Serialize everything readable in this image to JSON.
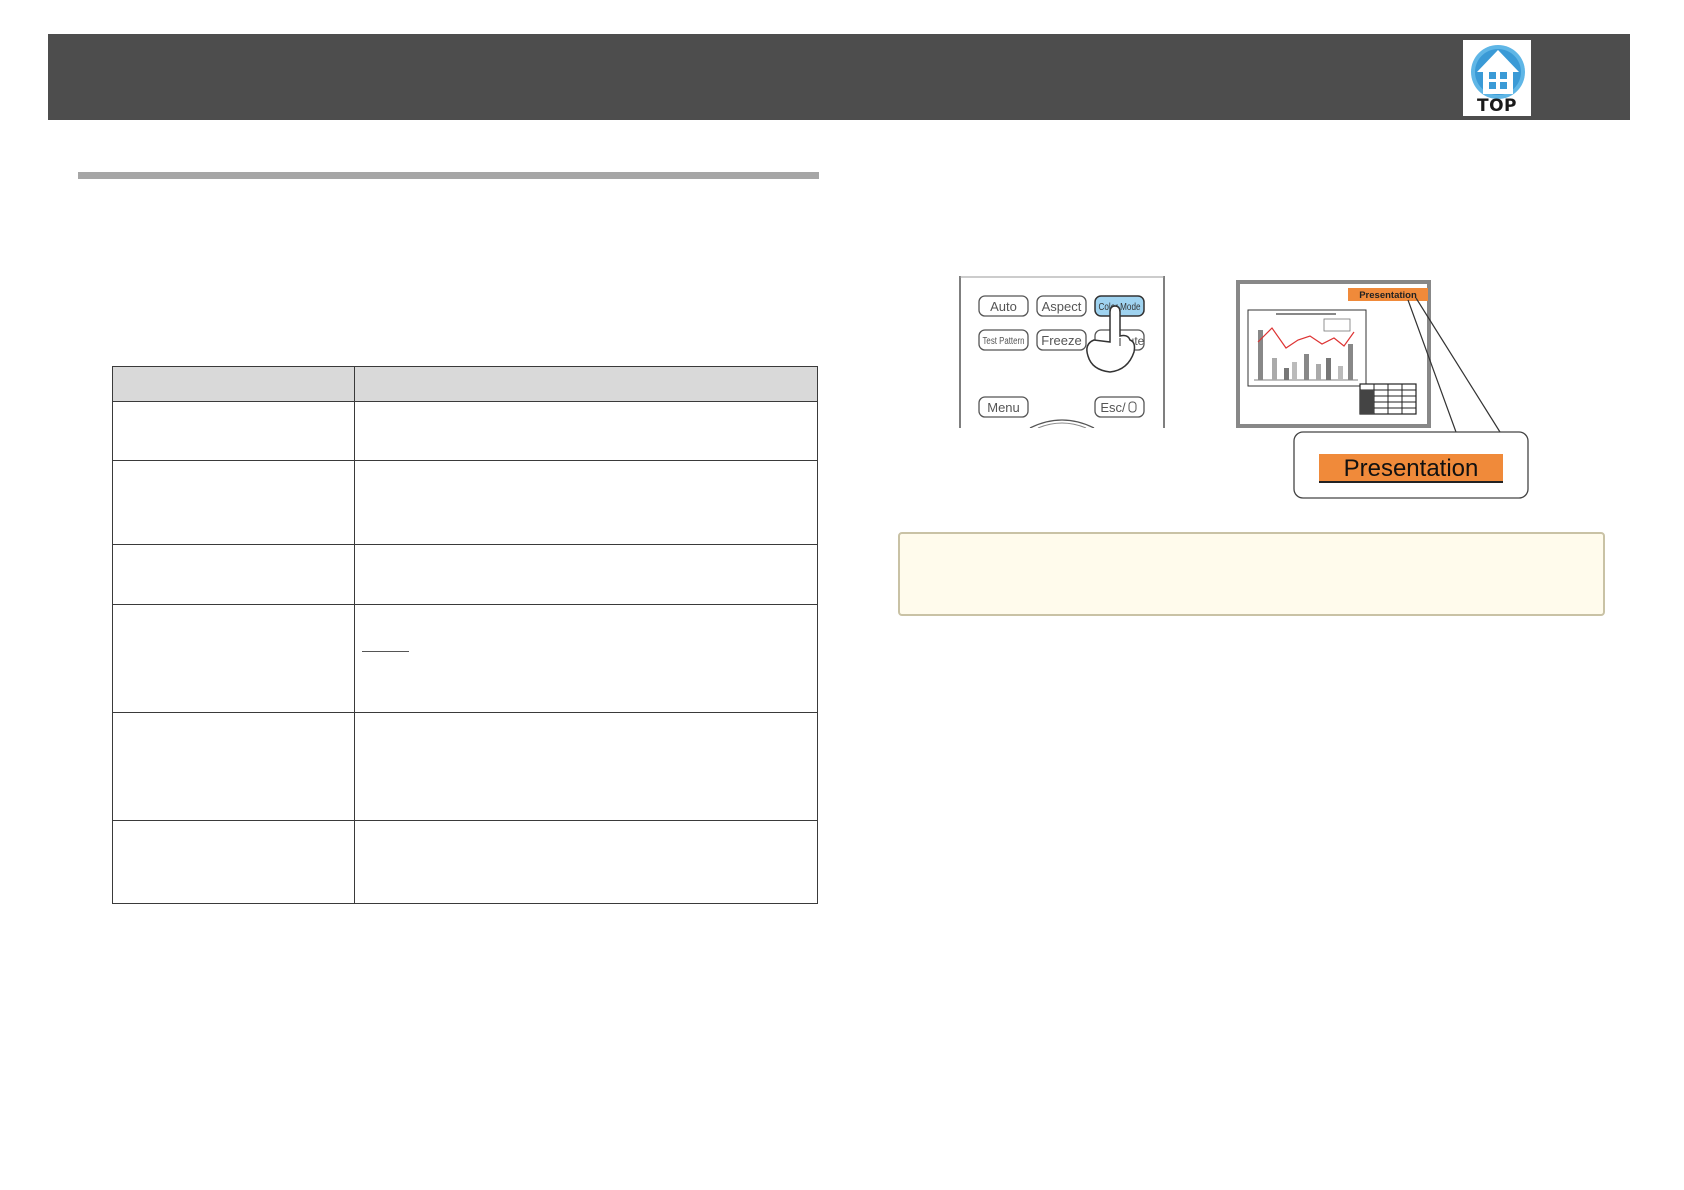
{
  "header": {
    "top_label": "TOP"
  },
  "colors": {
    "header_bg": "#4d4d4d",
    "accent_orange": "#f08a3a",
    "color_mode_blue": "#9fd3f0",
    "note_bg": "#fffbec"
  },
  "remote": {
    "buttons": [
      "Auto",
      "Aspect",
      "Color Mode",
      "Test Pattern",
      "Freeze",
      "ute",
      "Menu",
      "Esc/"
    ]
  },
  "screen": {
    "badge_small": "Presentation",
    "callout": "Presentation"
  },
  "table": {
    "rows": 6
  }
}
